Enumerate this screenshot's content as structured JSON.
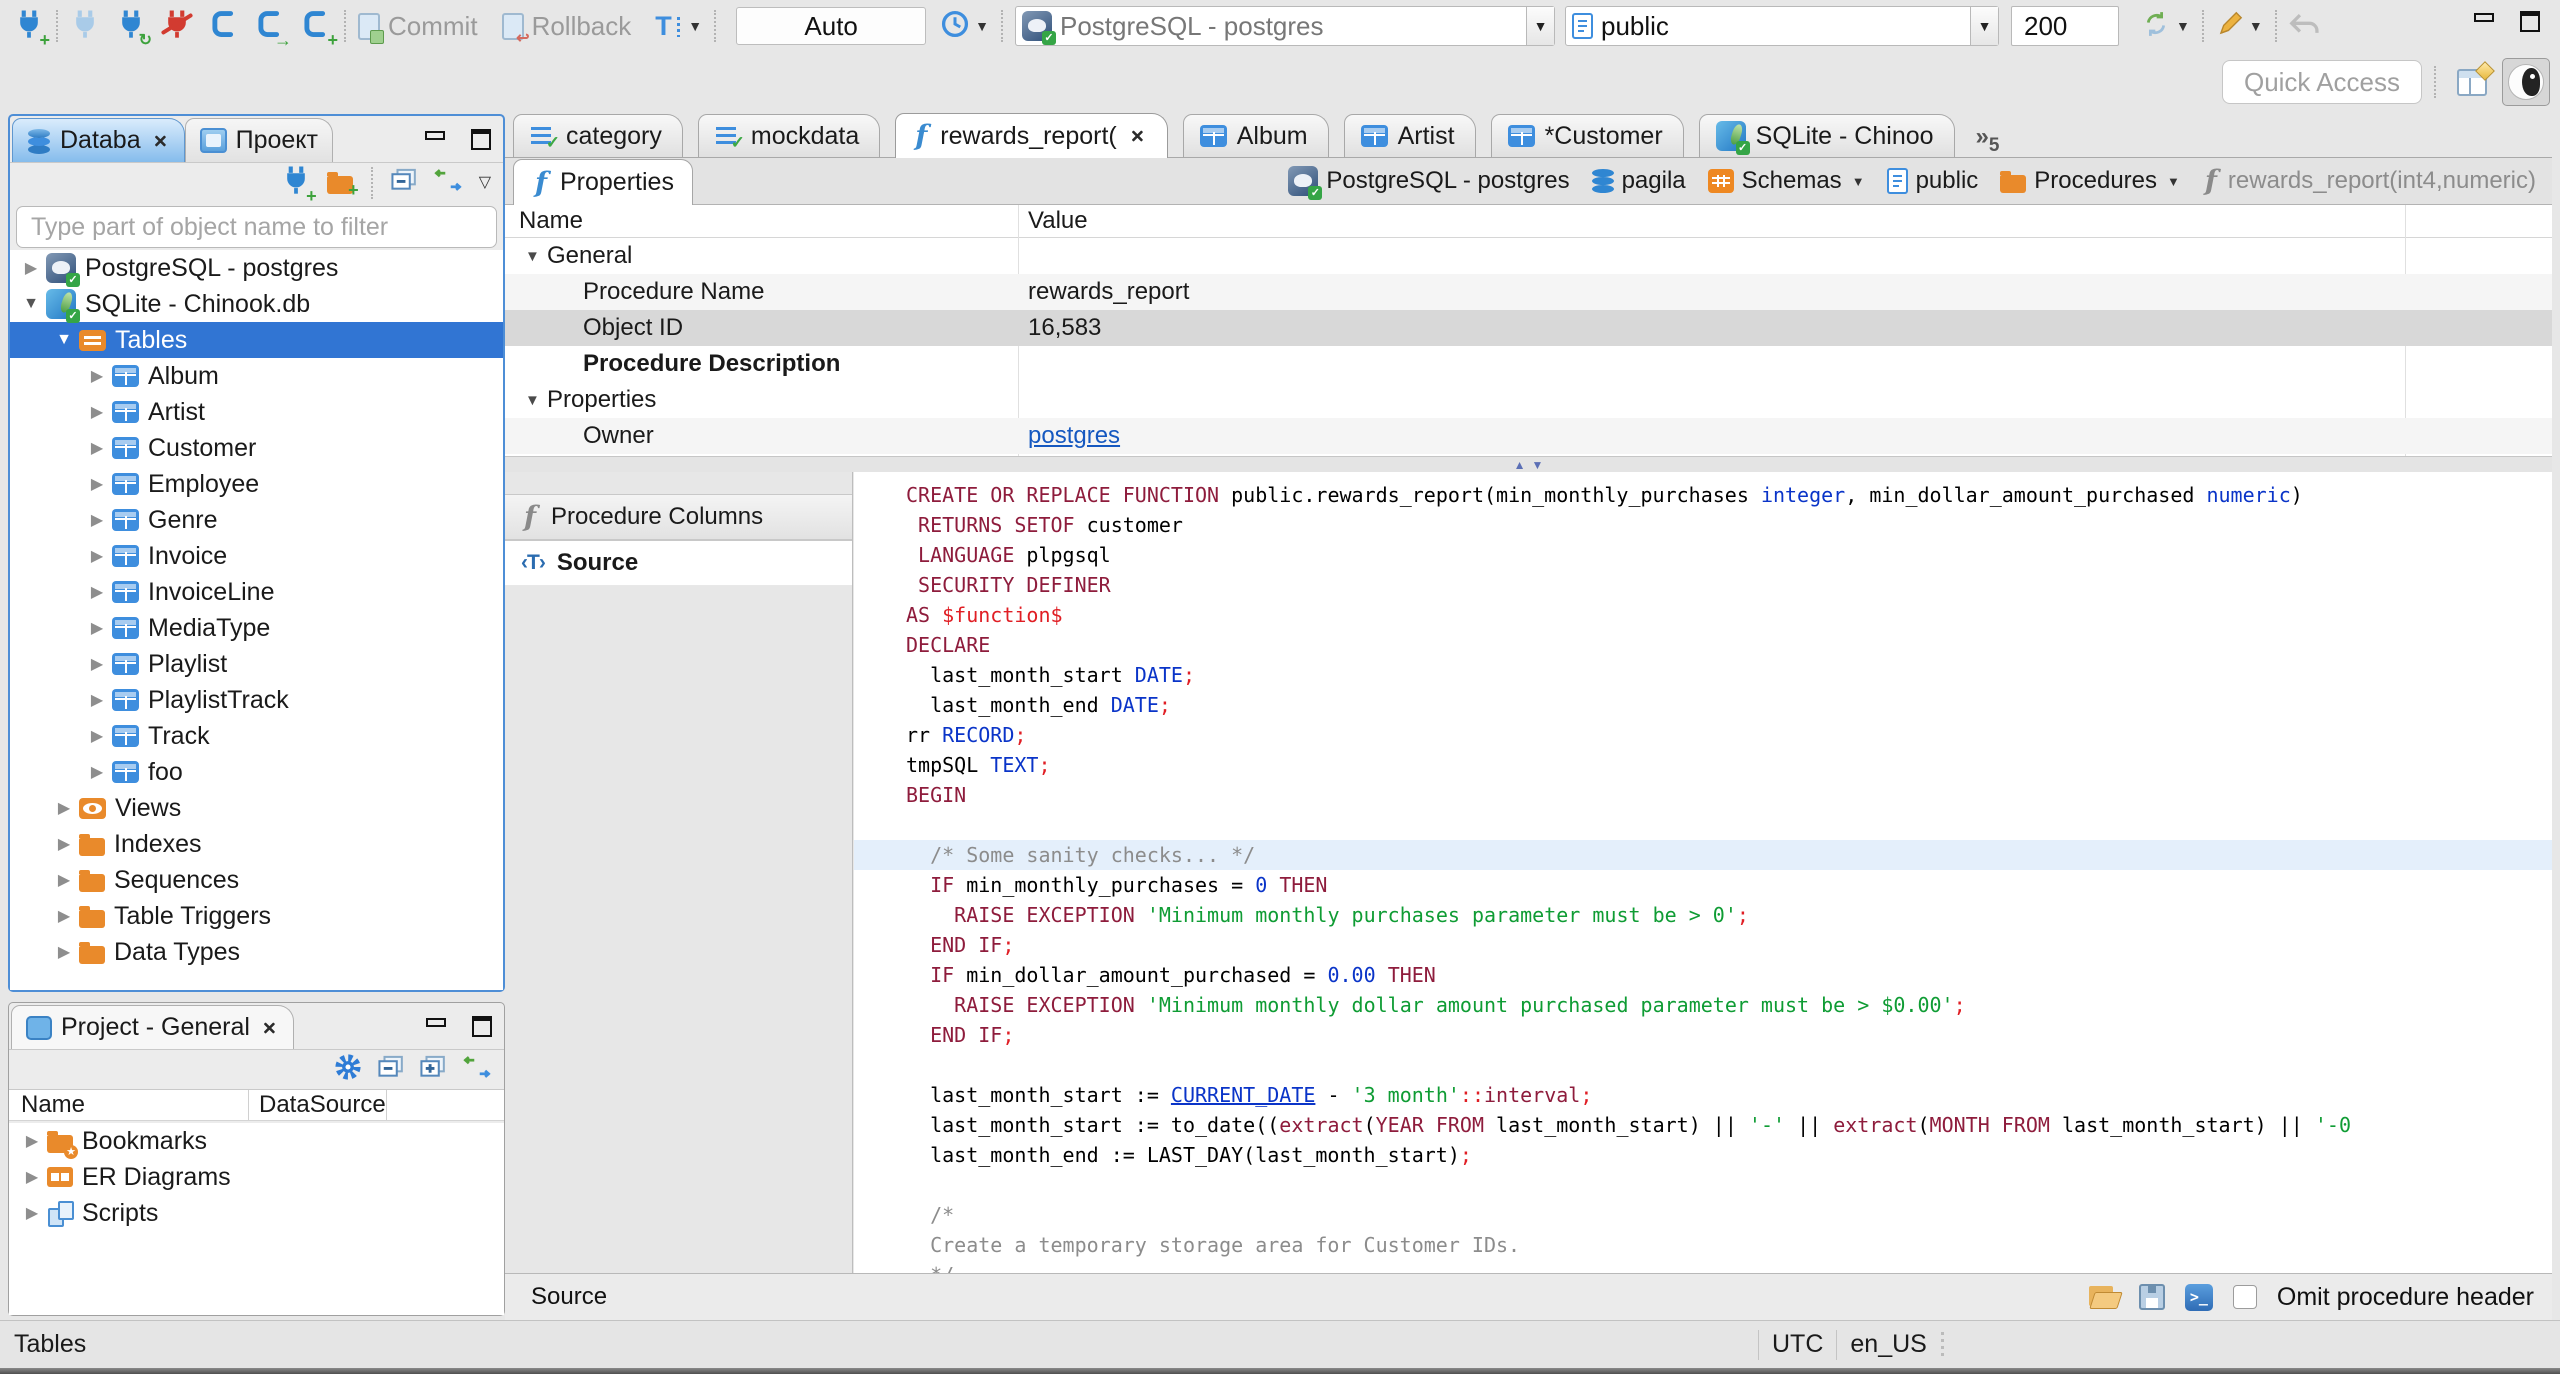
{
  "toolbar": {
    "commit_label": "Commit",
    "rollback_label": "Rollback",
    "txn_mode": "Auto",
    "connection": "PostgreSQL - postgres",
    "schema": "public",
    "fetch_size": "200",
    "quick_access_placeholder": "Quick Access"
  },
  "navigator": {
    "tab_database": "Databa",
    "tab_project": "Проект",
    "filter_placeholder": "Type part of object name to filter",
    "tree": [
      {
        "label": "PostgreSQL - postgres",
        "icon": "pgconn",
        "exp": "collapsed",
        "depth": 0
      },
      {
        "label": "SQLite - Chinook.db",
        "icon": "sqliteconn",
        "exp": "expanded",
        "depth": 0
      },
      {
        "label": "Tables",
        "icon": "tables",
        "exp": "expanded",
        "depth": 1,
        "selected": true
      },
      {
        "label": "Album",
        "icon": "table",
        "exp": "collapsed",
        "depth": 2
      },
      {
        "label": "Artist",
        "icon": "table",
        "exp": "collapsed",
        "depth": 2
      },
      {
        "label": "Customer",
        "icon": "table",
        "exp": "collapsed",
        "depth": 2
      },
      {
        "label": "Employee",
        "icon": "table",
        "exp": "collapsed",
        "depth": 2
      },
      {
        "label": "Genre",
        "icon": "table",
        "exp": "collapsed",
        "depth": 2
      },
      {
        "label": "Invoice",
        "icon": "table",
        "exp": "collapsed",
        "depth": 2
      },
      {
        "label": "InvoiceLine",
        "icon": "table",
        "exp": "collapsed",
        "depth": 2
      },
      {
        "label": "MediaType",
        "icon": "table",
        "exp": "collapsed",
        "depth": 2
      },
      {
        "label": "Playlist",
        "icon": "table",
        "exp": "collapsed",
        "depth": 2
      },
      {
        "label": "PlaylistTrack",
        "icon": "table",
        "exp": "collapsed",
        "depth": 2
      },
      {
        "label": "Track",
        "icon": "table",
        "exp": "collapsed",
        "depth": 2
      },
      {
        "label": "foo",
        "icon": "table",
        "exp": "collapsed",
        "depth": 2
      },
      {
        "label": "Views",
        "icon": "views",
        "exp": "collapsed",
        "depth": 1
      },
      {
        "label": "Indexes",
        "icon": "folder",
        "exp": "collapsed",
        "depth": 1
      },
      {
        "label": "Sequences",
        "icon": "folder",
        "exp": "collapsed",
        "depth": 1
      },
      {
        "label": "Table Triggers",
        "icon": "folder",
        "exp": "collapsed",
        "depth": 1
      },
      {
        "label": "Data Types",
        "icon": "folder",
        "exp": "collapsed",
        "depth": 1
      }
    ]
  },
  "project_panel": {
    "title": "Project - General",
    "columns": [
      "Name",
      "DataSource"
    ],
    "tree": [
      {
        "label": "Bookmarks",
        "icon": "folder_star"
      },
      {
        "label": "ER Diagrams",
        "icon": "erd"
      },
      {
        "label": "Scripts",
        "icon": "scripts"
      }
    ]
  },
  "editor_tabs": [
    {
      "label": "category",
      "icon": "script"
    },
    {
      "label": "mockdata",
      "icon": "script"
    },
    {
      "label": "rewards_report(",
      "icon": "fx",
      "active": true
    },
    {
      "label": "Album",
      "icon": "table"
    },
    {
      "label": "Artist",
      "icon": "table"
    },
    {
      "label": "*Customer",
      "icon": "table"
    },
    {
      "label": "SQLite - Chinoo",
      "icon": "sqliteconn"
    }
  ],
  "tab_overflow_count": "5",
  "object_editor": {
    "tab_properties": "Properties",
    "breadcrumb": [
      {
        "label": "PostgreSQL - postgres",
        "icon": "pgconn"
      },
      {
        "label": "pagila",
        "icon": "db"
      },
      {
        "label": "Schemas",
        "icon": "schemas",
        "dropdown": true
      },
      {
        "label": "public",
        "icon": "page"
      },
      {
        "label": "Procedures",
        "icon": "folder",
        "dropdown": true
      },
      {
        "label": "rewards_report(int4,numeric)",
        "icon": "fx_gray",
        "muted": true
      }
    ],
    "grid_columns": [
      "Name",
      "Value"
    ],
    "grid_rows": [
      {
        "name": "General",
        "group": true
      },
      {
        "name": "Procedure Name",
        "value": "rewards_report",
        "shade": true
      },
      {
        "name": "Object ID",
        "value": "16,583",
        "selected": true
      },
      {
        "name": "Procedure Description",
        "bold": true
      },
      {
        "name": "Properties",
        "group": true
      },
      {
        "name": "Owner",
        "value": "postgres",
        "link": true,
        "shade": true
      }
    ],
    "subtabs": [
      {
        "label": "Procedure Columns",
        "icon": "fx_gray"
      },
      {
        "label": "Source",
        "icon": "srct",
        "active": true
      }
    ],
    "status_label": "Source",
    "omit_checkbox_label": "Omit procedure header"
  },
  "code": {
    "lines": [
      {
        "s": [
          [
            "k",
            "CREATE OR REPLACE FUNCTION"
          ],
          [
            "p",
            " public.rewards_report(min_monthly_purchases "
          ],
          [
            "t",
            "integer"
          ],
          [
            "p",
            ", min_dollar_amount_purchased "
          ],
          [
            "t",
            "numeric"
          ],
          [
            "p",
            ")"
          ]
        ]
      },
      {
        "s": [
          [
            "p",
            " "
          ],
          [
            "k",
            "RETURNS SETOF"
          ],
          [
            "p",
            " customer"
          ]
        ]
      },
      {
        "s": [
          [
            "p",
            " "
          ],
          [
            "k",
            "LANGUAGE"
          ],
          [
            "p",
            " plpgsql"
          ]
        ]
      },
      {
        "s": [
          [
            "p",
            " "
          ],
          [
            "k",
            "SECURITY DEFINER"
          ]
        ]
      },
      {
        "s": [
          [
            "k",
            "AS"
          ],
          [
            "r",
            " $function$"
          ]
        ]
      },
      {
        "s": [
          [
            "k",
            "DECLARE"
          ]
        ]
      },
      {
        "s": [
          [
            "p",
            "  last_month_start "
          ],
          [
            "t",
            "DATE"
          ],
          [
            "r",
            ";"
          ]
        ]
      },
      {
        "s": [
          [
            "p",
            "  last_month_end "
          ],
          [
            "t",
            "DATE"
          ],
          [
            "r",
            ";"
          ]
        ]
      },
      {
        "s": [
          [
            "p",
            "rr "
          ],
          [
            "t",
            "RECORD"
          ],
          [
            "r",
            ";"
          ]
        ]
      },
      {
        "s": [
          [
            "p",
            "tmpSQL "
          ],
          [
            "t",
            "TEXT"
          ],
          [
            "r",
            ";"
          ]
        ]
      },
      {
        "s": [
          [
            "k",
            "BEGIN"
          ]
        ]
      },
      {
        "s": []
      },
      {
        "hl": true,
        "s": [
          [
            "c",
            "  /* Some sanity checks... */"
          ]
        ]
      },
      {
        "s": [
          [
            "p",
            "  "
          ],
          [
            "k",
            "IF"
          ],
          [
            "p",
            " min_monthly_purchases = "
          ],
          [
            "n",
            "0"
          ],
          [
            "p",
            " "
          ],
          [
            "k",
            "THEN"
          ]
        ]
      },
      {
        "s": [
          [
            "p",
            "    "
          ],
          [
            "k",
            "RAISE EXCEPTION"
          ],
          [
            "p",
            " "
          ],
          [
            "g",
            "'Minimum monthly purchases parameter must be > 0'"
          ],
          [
            "r",
            ";"
          ]
        ]
      },
      {
        "s": [
          [
            "p",
            "  "
          ],
          [
            "k",
            "END IF"
          ],
          [
            "r",
            ";"
          ]
        ]
      },
      {
        "s": [
          [
            "p",
            "  "
          ],
          [
            "k",
            "IF"
          ],
          [
            "p",
            " min_dollar_amount_purchased = "
          ],
          [
            "n",
            "0.00"
          ],
          [
            "p",
            " "
          ],
          [
            "k",
            "THEN"
          ]
        ]
      },
      {
        "s": [
          [
            "p",
            "    "
          ],
          [
            "k",
            "RAISE EXCEPTION"
          ],
          [
            "p",
            " "
          ],
          [
            "g",
            "'Minimum monthly dollar amount purchased parameter must be > $0.00'"
          ],
          [
            "r",
            ";"
          ]
        ]
      },
      {
        "s": [
          [
            "p",
            "  "
          ],
          [
            "k",
            "END IF"
          ],
          [
            "r",
            ";"
          ]
        ]
      },
      {
        "s": []
      },
      {
        "s": [
          [
            "p",
            "  last_month_start := "
          ],
          [
            "u",
            "CURRENT_DATE"
          ],
          [
            "p",
            " - "
          ],
          [
            "g",
            "'3 month'"
          ],
          [
            "r",
            "::"
          ],
          [
            "k",
            "interval"
          ],
          [
            "r",
            ";"
          ]
        ]
      },
      {
        "s": [
          [
            "p",
            "  last_month_start := to_date(("
          ],
          [
            "k",
            "extract"
          ],
          [
            "p",
            "("
          ],
          [
            "k",
            "YEAR FROM"
          ],
          [
            "p",
            " last_month_start) || "
          ],
          [
            "g",
            "'-'"
          ],
          [
            "p",
            " || "
          ],
          [
            "k",
            "extract"
          ],
          [
            "p",
            "("
          ],
          [
            "k",
            "MONTH FROM"
          ],
          [
            "p",
            " last_month_start) || "
          ],
          [
            "g",
            "'-0"
          ]
        ]
      },
      {
        "s": [
          [
            "p",
            "  last_month_end := LAST_DAY(last_month_start)"
          ],
          [
            "r",
            ";"
          ]
        ]
      },
      {
        "s": []
      },
      {
        "s": [
          [
            "c",
            "  /*"
          ]
        ]
      },
      {
        "s": [
          [
            "c",
            "  Create a temporary storage area for Customer IDs."
          ]
        ]
      },
      {
        "s": [
          [
            "c",
            "  */"
          ]
        ]
      }
    ]
  },
  "statusbar": {
    "selection": "Tables",
    "timezone": "UTC",
    "locale": "en_US"
  }
}
